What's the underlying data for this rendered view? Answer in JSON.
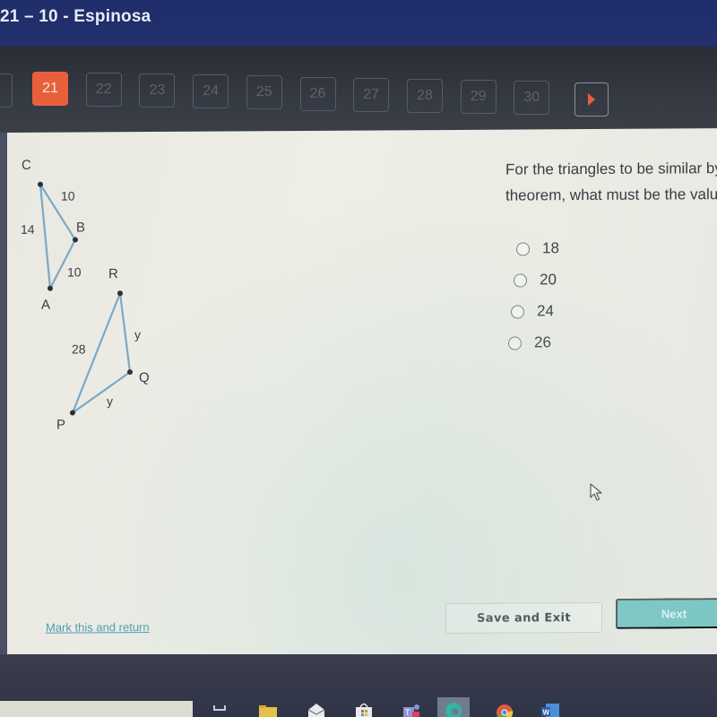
{
  "window": {
    "title": "21 – 10 - Espinosa"
  },
  "navigation": {
    "previous_partial_label": "",
    "questions": [
      {
        "label": "21",
        "state": "current"
      },
      {
        "label": "22",
        "state": "inactive"
      },
      {
        "label": "23",
        "state": "inactive"
      },
      {
        "label": "24",
        "state": "inactive"
      },
      {
        "label": "25",
        "state": "inactive"
      },
      {
        "label": "26",
        "state": "inactive"
      },
      {
        "label": "27",
        "state": "inactive"
      },
      {
        "label": "28",
        "state": "inactive"
      },
      {
        "label": "29",
        "state": "inactive"
      },
      {
        "label": "30",
        "state": "inactive"
      }
    ],
    "next_arrow_icon": "play-arrow-icon"
  },
  "figure": {
    "triangle_abc": {
      "vertices": {
        "A": "A",
        "B": "B",
        "C": "C"
      },
      "sides": {
        "CB": "10",
        "CA": "14",
        "AB": "10"
      }
    },
    "triangle_pqr": {
      "vertices": {
        "P": "P",
        "Q": "Q",
        "R": "R"
      },
      "sides": {
        "PR": "28",
        "RQ": "y",
        "PQ": "y"
      }
    }
  },
  "question": {
    "line1": "For the triangles to be similar by the SSS similarity",
    "line2": "theorem, what must be the value of y?",
    "options": [
      {
        "label": "18",
        "selected": false
      },
      {
        "label": "20",
        "selected": false
      },
      {
        "label": "24",
        "selected": false
      },
      {
        "label": "26",
        "selected": false
      }
    ]
  },
  "actions": {
    "mark_link": "Mark this and return",
    "save_exit": "Save and Exit",
    "next": "Next"
  },
  "colors": {
    "accent": "#e8603b",
    "next_button": "#7bc7c4",
    "title_bar": "#1f2d6b",
    "triangle_stroke": "#7aa9c9"
  },
  "taskbar": {
    "icons": [
      "task-view-icon",
      "file-explorer-icon",
      "mail-icon",
      "store-icon",
      "teams-icon",
      "edge-icon",
      "chrome-icon",
      "word-icon"
    ]
  }
}
